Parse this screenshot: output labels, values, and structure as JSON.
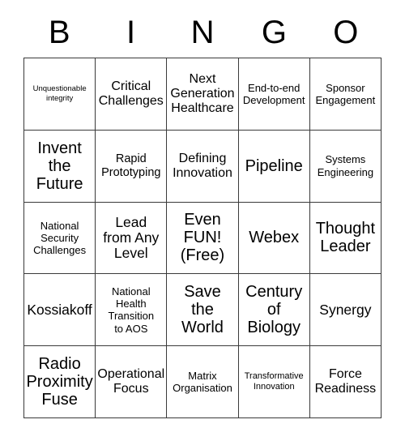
{
  "header": {
    "letters": [
      "B",
      "I",
      "N",
      "G",
      "O"
    ]
  },
  "grid": {
    "rows": 5,
    "columns": 5,
    "border_color": "#3a3a3a",
    "background_color": "#ffffff",
    "text_color": "#000000",
    "cells": [
      {
        "text": "Unquestionable\nintegrity",
        "size": "fs-xs",
        "free_space": false
      },
      {
        "text": "Critical\nChallenges",
        "size": "fs-ml",
        "free_space": false
      },
      {
        "text": "Next\nGeneration\nHealthcare",
        "size": "fs-ml",
        "free_space": false
      },
      {
        "text": "End-to-end\nDevelopment",
        "size": "fs-sm",
        "free_space": false
      },
      {
        "text": "Sponsor\nEngagement",
        "size": "fs-sm",
        "free_space": false
      },
      {
        "text": "Invent\nthe\nFuture",
        "size": "fs-xl",
        "free_space": false
      },
      {
        "text": "Rapid\nPrototyping",
        "size": "fs-m",
        "free_space": false
      },
      {
        "text": "Defining\nInnovation",
        "size": "fs-ml",
        "free_space": false
      },
      {
        "text": "Pipeline",
        "size": "fs-xl",
        "free_space": false
      },
      {
        "text": "Systems\nEngineering",
        "size": "fs-sm",
        "free_space": false
      },
      {
        "text": "National\nSecurity\nChallenges",
        "size": "fs-sm",
        "free_space": false
      },
      {
        "text": "Lead\nfrom Any\nLevel",
        "size": "fs-l",
        "free_space": false
      },
      {
        "text": "Even\nFUN!\n(Free)",
        "size": "fs-xl",
        "free_space": true
      },
      {
        "text": "Webex",
        "size": "fs-xl",
        "free_space": false
      },
      {
        "text": "Thought\nLeader",
        "size": "fs-xl",
        "free_space": false
      },
      {
        "text": "Kossiakoff",
        "size": "fs-l",
        "free_space": false
      },
      {
        "text": "National\nHealth\nTransition\nto AOS",
        "size": "fs-sm",
        "free_space": false
      },
      {
        "text": "Save\nthe\nWorld",
        "size": "fs-xl",
        "free_space": false
      },
      {
        "text": "Century\nof\nBiology",
        "size": "fs-xl",
        "free_space": false
      },
      {
        "text": "Synergy",
        "size": "fs-l",
        "free_space": false
      },
      {
        "text": "Radio\nProximity\nFuse",
        "size": "fs-xl",
        "free_space": false
      },
      {
        "text": "Operational\nFocus",
        "size": "fs-ml",
        "free_space": false
      },
      {
        "text": "Matrix\nOrganisation",
        "size": "fs-sm",
        "free_space": false
      },
      {
        "text": "Transformative\nInnovation",
        "size": "fs-s",
        "free_space": false
      },
      {
        "text": "Force\nReadiness",
        "size": "fs-ml",
        "free_space": false
      }
    ]
  }
}
